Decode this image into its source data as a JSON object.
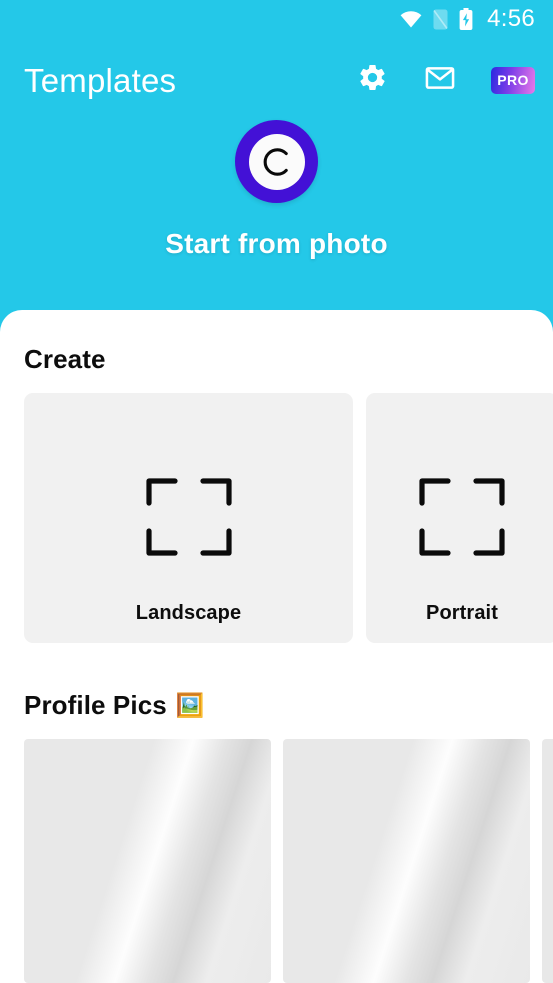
{
  "statusbar": {
    "time": "4:56",
    "icons": [
      "wifi-icon",
      "sim-off-icon",
      "battery-charging-icon"
    ]
  },
  "appbar": {
    "title": "Templates",
    "settings_icon": "gear-icon",
    "mail_icon": "envelope-icon",
    "pro_label": "PRO"
  },
  "hero": {
    "logo_letter": "C",
    "label": "Start from photo"
  },
  "create": {
    "heading": "Create",
    "cards": [
      {
        "label": "Landscape",
        "icon": "crop-frame-icon"
      },
      {
        "label": "Portrait",
        "icon": "crop-frame-icon"
      }
    ]
  },
  "profile_pics": {
    "heading": "Profile Pics",
    "emoji": "🖼️",
    "items": [
      {
        "state": "loading"
      },
      {
        "state": "loading"
      },
      {
        "state": "loading"
      }
    ]
  },
  "colors": {
    "brand_cyan": "#24c8e8",
    "logo_purple": "#4311d6",
    "card_gray": "#f1f1f1",
    "pro_gradient_start": "#2a2ae0",
    "pro_gradient_end": "#e87ae8"
  }
}
